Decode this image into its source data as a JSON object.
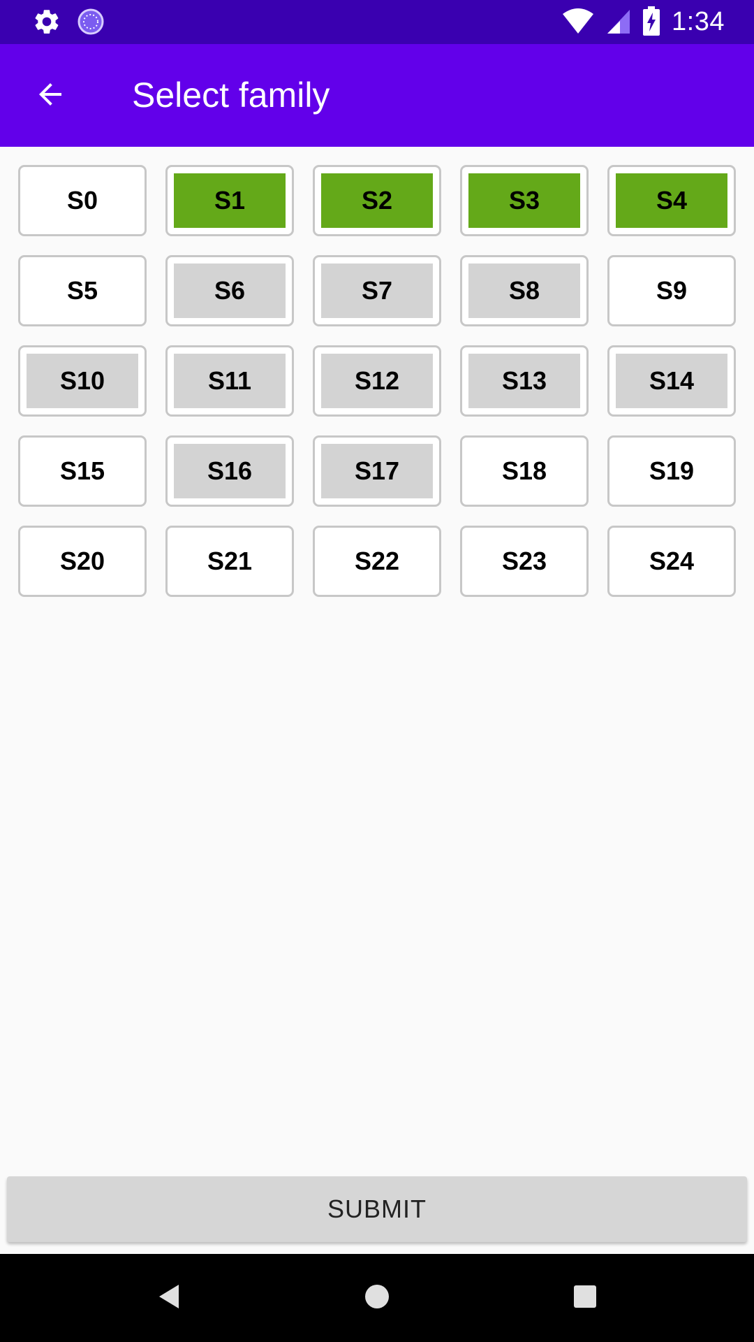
{
  "status_bar": {
    "time": "1:34",
    "left_icons": [
      "settings-icon",
      "sync-circle-icon"
    ],
    "right_icons": [
      "wifi-icon",
      "cell-signal-icon",
      "battery-charging-icon"
    ]
  },
  "app_bar": {
    "back_icon": "arrow-back-icon",
    "title": "Select family"
  },
  "families": [
    {
      "label": "S0",
      "state": "available"
    },
    {
      "label": "S1",
      "state": "selected"
    },
    {
      "label": "S2",
      "state": "selected"
    },
    {
      "label": "S3",
      "state": "selected"
    },
    {
      "label": "S4",
      "state": "selected"
    },
    {
      "label": "S5",
      "state": "available"
    },
    {
      "label": "S6",
      "state": "disabled"
    },
    {
      "label": "S7",
      "state": "disabled"
    },
    {
      "label": "S8",
      "state": "disabled"
    },
    {
      "label": "S9",
      "state": "available"
    },
    {
      "label": "S10",
      "state": "disabled"
    },
    {
      "label": "S11",
      "state": "disabled"
    },
    {
      "label": "S12",
      "state": "disabled"
    },
    {
      "label": "S13",
      "state": "disabled"
    },
    {
      "label": "S14",
      "state": "disabled"
    },
    {
      "label": "S15",
      "state": "available"
    },
    {
      "label": "S16",
      "state": "disabled"
    },
    {
      "label": "S17",
      "state": "disabled"
    },
    {
      "label": "S18",
      "state": "available"
    },
    {
      "label": "S19",
      "state": "available"
    },
    {
      "label": "S20",
      "state": "available"
    },
    {
      "label": "S21",
      "state": "available"
    },
    {
      "label": "S22",
      "state": "available"
    },
    {
      "label": "S23",
      "state": "available"
    },
    {
      "label": "S24",
      "state": "available"
    }
  ],
  "submit_label": "SUBMIT",
  "nav_bar": {
    "icons": [
      "back-triangle-icon",
      "home-circle-icon",
      "recents-square-icon"
    ]
  },
  "colors": {
    "status_bar": "#3a00b0",
    "app_bar": "#6200ea",
    "selected": "#64a919",
    "disabled": "#d3d3d3",
    "background": "#fafafa"
  }
}
